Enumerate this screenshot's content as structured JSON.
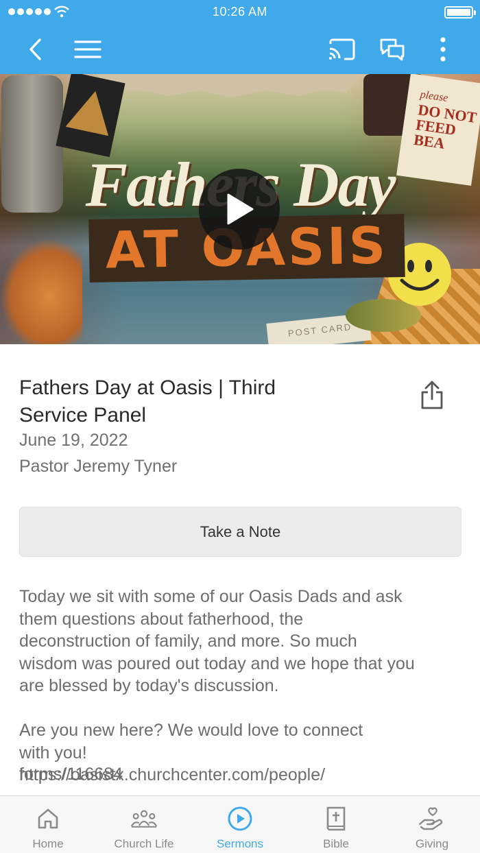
{
  "status_bar": {
    "time": "10:26 AM"
  },
  "colors": {
    "accent": "#3fa9ea",
    "tab_inactive": "#8a8a8a",
    "button_bg": "#ececec"
  },
  "nav_bar": {
    "icons": [
      "back-icon",
      "menu-icon",
      "cast-icon",
      "chat-icon",
      "more-vertical-icon"
    ]
  },
  "hero": {
    "title_line1": "Fathers Day",
    "title_line2": "AT OASIS",
    "sign_line1": "please",
    "sign_line2": "DO NOT",
    "sign_line3": "FEED",
    "sign_line4": "BEA",
    "postcard": "POST CARD",
    "play_icon": "play-icon"
  },
  "sermon": {
    "title": "Fathers Day at Oasis | Third Service Panel",
    "date": "June 19, 2022",
    "pastor": "Pastor Jeremy Tyner",
    "share_icon": "share-icon",
    "note_button": "Take a Note",
    "description": "Today we sit with some of our Oasis Dads and ask\nthem questions about fatherhood, the\ndeconstruction of family, and more.  So much\nwisdom was poured out today and we hope that you\nare blessed by today's discussion.\n\nAre you new here? We would love to connect\nwith you!\nhttps://oasistx.churchcenter.com/people/",
    "description_cut": "forms/116684"
  },
  "tabs": [
    {
      "label": "Home",
      "icon": "home-icon",
      "active": false
    },
    {
      "label": "Church Life",
      "icon": "people-icon",
      "active": false
    },
    {
      "label": "Sermons",
      "icon": "play-circle-icon",
      "active": true
    },
    {
      "label": "Bible",
      "icon": "bible-icon",
      "active": false
    },
    {
      "label": "Giving",
      "icon": "giving-hand-icon",
      "active": false
    }
  ]
}
